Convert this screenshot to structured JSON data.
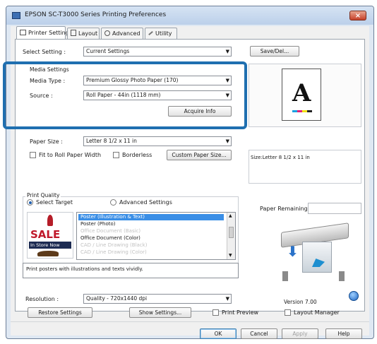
{
  "window": {
    "title": "EPSON SC-T3000 Series Printing Preferences",
    "close": "×"
  },
  "tabs": [
    {
      "label": "Printer Settings",
      "active": true
    },
    {
      "label": "Layout",
      "active": false
    },
    {
      "label": "Advanced",
      "active": false
    },
    {
      "label": "Utility",
      "active": false
    }
  ],
  "select_setting": {
    "label": "Select Setting :",
    "value": "Current Settings",
    "save_button": "Save/Del..."
  },
  "media_settings": {
    "title": "Media Settings",
    "media_type_label": "Media Type :",
    "media_type_value": "Premium Glossy Photo Paper (170)",
    "source_label": "Source :",
    "source_value": "Roll Paper - 44in (1118 mm)",
    "acquire_button": "Acquire Info"
  },
  "paper": {
    "paper_size_label": "Paper Size :",
    "paper_size_value": "Letter 8 1/2 x 11 in",
    "fit_label": "Fit to Roll Paper Width",
    "borderless_label": "Borderless",
    "custom_button": "Custom Paper Size..."
  },
  "preview": {
    "letter": "A",
    "size_text": "Size:Letter 8 1/2 x 11 in",
    "paper_remaining_label": "Paper Remaining:",
    "version": "Version 7.00"
  },
  "print_quality": {
    "title": "Print Quality",
    "select_target": "Select Target",
    "advanced_settings": "Advanced Settings",
    "targets": [
      {
        "label": "Poster (Illustration & Text)",
        "state": "selected"
      },
      {
        "label": "Poster (Photo)",
        "state": "normal"
      },
      {
        "label": "Office Document (Basic)",
        "state": "dim"
      },
      {
        "label": "Office Document (Color)",
        "state": "normal"
      },
      {
        "label": "CAD / Line Drawing (Black)",
        "state": "dim"
      },
      {
        "label": "CAD / Line Drawing (Color)",
        "state": "dim"
      }
    ],
    "sale_title": "SALE",
    "sale_banner": "In Store Now",
    "description": "Print posters with illustrations and texts vividly.",
    "resolution_label": "Resolution :",
    "resolution_value": "Quality - 720x1440 dpi"
  },
  "bottom": {
    "restore_button": "Restore Settings",
    "show_button": "Show Settings...",
    "print_preview": "Print Preview",
    "layout_manager": "Layout Manager"
  },
  "dialog": {
    "ok": "OK",
    "cancel": "Cancel",
    "apply": "Apply",
    "help": "Help"
  },
  "colors": {
    "accent": "#1f6fb0",
    "selection": "#3a8ee6"
  }
}
